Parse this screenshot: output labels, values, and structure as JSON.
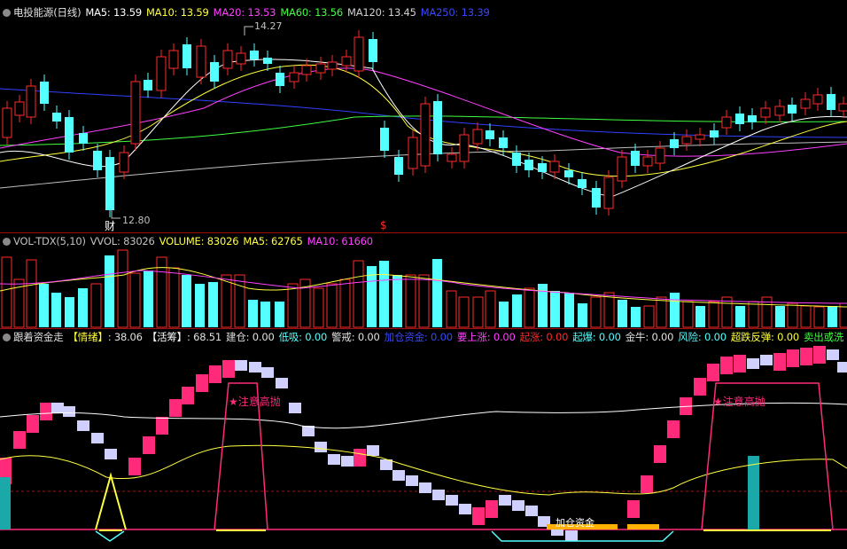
{
  "colors": {
    "up": "#ff2a2a",
    "down": "#54ffff",
    "ma5": "#ffffff",
    "ma10": "#ffff40",
    "ma20": "#ff40ff",
    "ma60": "#40ff40",
    "ma120": "#c0c0c0",
    "ma250": "#3040ff",
    "pink": "#ff2a7a",
    "lav": "#d0d0ff",
    "teal": "#1aa8a8"
  },
  "price_panel": {
    "icon": "chevron-down-icon",
    "title": "电投能源(日线)",
    "ma5": "MA5: 13.59",
    "ma10": "MA10: 13.59",
    "ma20": "MA20: 13.53",
    "ma60": "MA60: 13.56",
    "ma120": "MA120: 13.45",
    "ma250": "MA250: 13.39",
    "high_label": "14.27",
    "low_label": "12.80",
    "marker_cai": "财",
    "marker_s": "$"
  },
  "volume_panel": {
    "icon": "chevron-down-icon",
    "name": "VOL-TDX(5,10)",
    "vvol": "VVOL: 83026",
    "volume": "VOLUME: 83026",
    "ma5": "MA5: 62765",
    "ma10": "MA10: 61660"
  },
  "indicator_panel": {
    "icon": "chevron-down-icon",
    "name": "跟着资金走",
    "mood_label": "【情绪】",
    "mood_value": ": 38.06",
    "active_label": "【活筹】",
    "active_value": ": 68.51",
    "jiancang": "建仓: 0.00",
    "dixi": "低吸: 0.00",
    "jingjie": "警戒: 0.00",
    "jiacang": "加仓资金: 0.00",
    "yaoshangzhang": "要上涨: 0.00",
    "qizhang": "起涨: 0.00",
    "qibao": "起爆: 0.00",
    "jinniu": "金牛: 0.00",
    "fengxian": "风险: 0.00",
    "chaodie": "超跌反弹: 0.00",
    "maichu": "卖出或洗",
    "note1": "★注意高抛",
    "note2": "★注意高抛",
    "note3": "加仓资金"
  }
}
